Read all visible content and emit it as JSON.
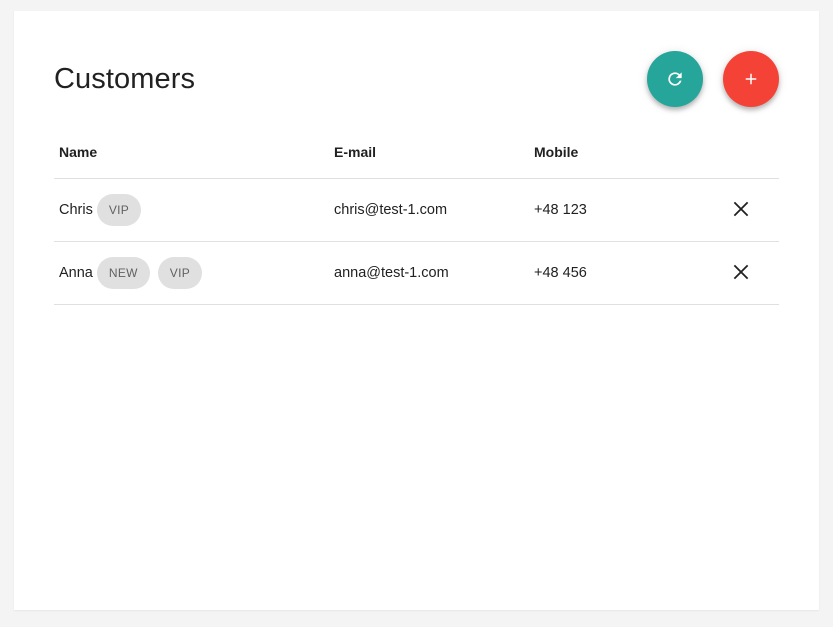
{
  "page": {
    "title": "Customers"
  },
  "actions": {
    "refresh_icon": "refresh-icon",
    "add_icon": "plus-icon"
  },
  "colors": {
    "refresh_button": "#26a69a",
    "add_button": "#f44336",
    "chip_background": "#e0e0e0"
  },
  "table": {
    "headers": {
      "name": "Name",
      "email": "E-mail",
      "mobile": "Mobile"
    },
    "rows": [
      {
        "name": "Chris",
        "tags": [
          "VIP"
        ],
        "email": "chris@test-1.com",
        "mobile": "+48 123",
        "delete_icon": "close-icon"
      },
      {
        "name": "Anna",
        "tags": [
          "NEW",
          "VIP"
        ],
        "email": "anna@test-1.com",
        "mobile": "+48 456",
        "delete_icon": "close-icon"
      }
    ]
  }
}
